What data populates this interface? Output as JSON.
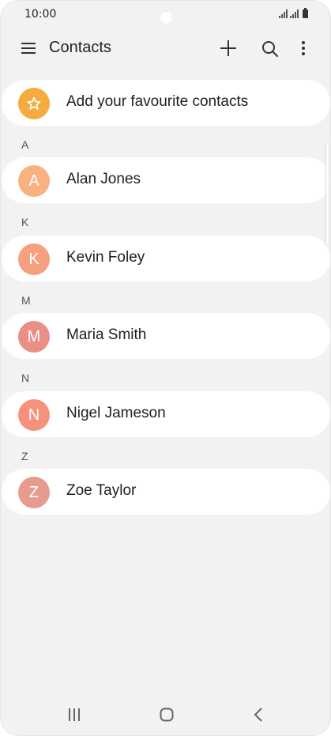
{
  "status_bar": {
    "time": "10:00"
  },
  "app_bar": {
    "title": "Contacts",
    "menu_icon": "hamburger-menu-icon",
    "add_icon": "plus-icon",
    "search_icon": "search-icon",
    "more_icon": "more-vertical-icon"
  },
  "favourites": {
    "label": "Add your favourite contacts",
    "icon": "star-icon",
    "color": "#f5ab3f"
  },
  "sections": [
    {
      "letter": "A",
      "contact": {
        "name": "Alan Jones",
        "initial": "A",
        "color": "#f9b27f"
      }
    },
    {
      "letter": "K",
      "contact": {
        "name": "Kevin Foley",
        "initial": "K",
        "color": "#f6a07f"
      }
    },
    {
      "letter": "M",
      "contact": {
        "name": "Maria Smith",
        "initial": "M",
        "color": "#ea8f86"
      }
    },
    {
      "letter": "N",
      "contact": {
        "name": "Nigel Jameson",
        "initial": "N",
        "color": "#f6927c"
      }
    },
    {
      "letter": "Z",
      "contact": {
        "name": "Zoe Taylor",
        "initial": "Z",
        "color": "#e79b8f"
      }
    }
  ],
  "nav_bar": {
    "recents_icon": "recent-apps-icon",
    "home_icon": "home-icon",
    "back_icon": "back-icon"
  }
}
